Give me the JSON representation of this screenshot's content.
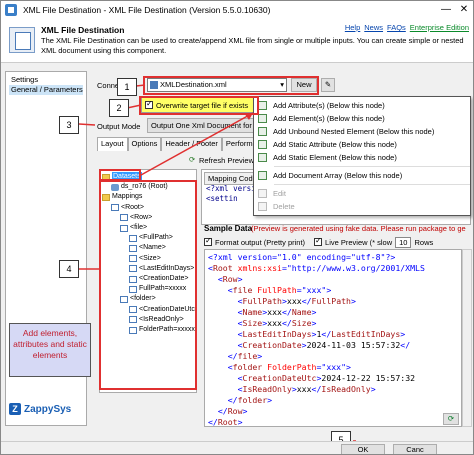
{
  "window": {
    "title": "XML File Destination - XML File Destination (Version 5.5.0.10630)",
    "minimize": "—",
    "close": "✕"
  },
  "header": {
    "title": "XML File Destination",
    "description": "The XML File Destination can be used to create/append XML file from single or multiple inputs. You can create simple or nested XML document using this component.",
    "links": [
      "Help",
      "News",
      "FAQs",
      "Enterprise Edition"
    ]
  },
  "leftnav": {
    "items": [
      "Settings",
      "General / Parameters"
    ]
  },
  "settings": {
    "connection_label": "Connec",
    "connection_value": "XMLDestination.xml",
    "new_button": "New",
    "overwrite_label": "Overwrite target file if exists",
    "output_mode_label": "Output Mode",
    "output_mode_value": "Output One Xml Document for all"
  },
  "tabs": [
    "Layout",
    "Options",
    "Header / Footer",
    "Performanc"
  ],
  "tree_toolbar": {
    "refresh": "Refresh Preview"
  },
  "tree": [
    {
      "label": "Datasets",
      "icon": "folder",
      "indent": 0,
      "selected": true
    },
    {
      "label": "ds_ro76 (Root)",
      "icon": "db",
      "indent": 1
    },
    {
      "label": "Mappings",
      "icon": "folder",
      "indent": 0
    },
    {
      "label": "<Root>",
      "icon": "doc",
      "indent": 1
    },
    {
      "label": "<Row>",
      "icon": "doc",
      "indent": 2
    },
    {
      "label": "<file>",
      "icon": "doc",
      "indent": 2
    },
    {
      "label": "<FullPath>",
      "icon": "doc",
      "indent": 3
    },
    {
      "label": "<Name>",
      "icon": "doc",
      "indent": 3
    },
    {
      "label": "<Size>",
      "icon": "doc",
      "indent": 3
    },
    {
      "label": "<LastEditInDays>",
      "icon": "doc",
      "indent": 3
    },
    {
      "label": "<CreationDate>",
      "icon": "doc",
      "indent": 3
    },
    {
      "label": "FullPath=xxxxx",
      "icon": "doc",
      "indent": 3
    },
    {
      "label": "<folder>",
      "icon": "doc",
      "indent": 2
    },
    {
      "label": "<CreationDateUtc>",
      "icon": "doc",
      "indent": 3
    },
    {
      "label": "<IsReadOnly>",
      "icon": "doc",
      "indent": 3
    },
    {
      "label": "FolderPath=xxxxx",
      "icon": "doc",
      "indent": 3
    }
  ],
  "mapping": {
    "tab": "Mapping Code",
    "lines": [
      "<?xml versio",
      "<settin"
    ]
  },
  "sample": {
    "title": "Sample Data",
    "note": "(Preview is generated using fake data. Please run package to ge",
    "format_output": "Format output (Pretty print)",
    "live_preview": "Live Preview (* slow",
    "rows_value": "10",
    "rows_label": "Rows"
  },
  "xml_preview": [
    [
      [
        "pl",
        "<?xml version=\"1.0\" encoding=\"utf-8\"?>"
      ]
    ],
    [
      [
        "pl",
        "<"
      ],
      [
        "tg",
        "Root"
      ],
      [
        "at",
        " xmlns:xsi"
      ],
      [
        "pl",
        "=\"http://www.w3.org/2001/XMLS"
      ]
    ],
    [
      [
        "pl",
        "  <"
      ],
      [
        "tg",
        "Row"
      ],
      [
        "pl",
        ">"
      ]
    ],
    [
      [
        "pl",
        "    <"
      ],
      [
        "tg",
        "file"
      ],
      [
        "at",
        " FullPath"
      ],
      [
        "pl",
        "=\"xxx\">"
      ]
    ],
    [
      [
        "pl",
        "      <"
      ],
      [
        "tg",
        "FullPath"
      ],
      [
        "pl",
        ">"
      ],
      [
        "tx",
        "xxx"
      ],
      [
        "pl",
        "</"
      ],
      [
        "tg",
        "FullPath"
      ],
      [
        "pl",
        ">"
      ]
    ],
    [
      [
        "pl",
        "      <"
      ],
      [
        "tg",
        "Name"
      ],
      [
        "pl",
        ">"
      ],
      [
        "tx",
        "xxx"
      ],
      [
        "pl",
        "</"
      ],
      [
        "tg",
        "Name"
      ],
      [
        "pl",
        ">"
      ]
    ],
    [
      [
        "pl",
        "      <"
      ],
      [
        "tg",
        "Size"
      ],
      [
        "pl",
        ">"
      ],
      [
        "tx",
        "xxx"
      ],
      [
        "pl",
        "</"
      ],
      [
        "tg",
        "Size"
      ],
      [
        "pl",
        ">"
      ]
    ],
    [
      [
        "pl",
        "      <"
      ],
      [
        "tg",
        "LastEditInDays"
      ],
      [
        "pl",
        ">"
      ],
      [
        "tx",
        "1"
      ],
      [
        "pl",
        "</"
      ],
      [
        "tg",
        "LastEditInDays"
      ],
      [
        "pl",
        ">"
      ]
    ],
    [
      [
        "pl",
        "      <"
      ],
      [
        "tg",
        "CreationDate"
      ],
      [
        "pl",
        ">"
      ],
      [
        "tx",
        "2024-11-03 15:57:32"
      ],
      [
        "pl",
        "</"
      ]
    ],
    [
      [
        "pl",
        "    </"
      ],
      [
        "tg",
        "file"
      ],
      [
        "pl",
        ">"
      ]
    ],
    [
      [
        "pl",
        "    <"
      ],
      [
        "tg",
        "folder"
      ],
      [
        "at",
        " FolderPath"
      ],
      [
        "pl",
        "=\"xxx\">"
      ]
    ],
    [
      [
        "pl",
        "      <"
      ],
      [
        "tg",
        "CreationDateUtc"
      ],
      [
        "pl",
        ">"
      ],
      [
        "tx",
        "2024-12-22 15:57:32"
      ]
    ],
    [
      [
        "pl",
        "      <"
      ],
      [
        "tg",
        "IsReadOnly"
      ],
      [
        "pl",
        ">"
      ],
      [
        "tx",
        "xxx"
      ],
      [
        "pl",
        "</"
      ],
      [
        "tg",
        "IsReadOnly"
      ],
      [
        "pl",
        ">"
      ]
    ],
    [
      [
        "pl",
        "    </"
      ],
      [
        "tg",
        "folder"
      ],
      [
        "pl",
        ">"
      ]
    ],
    [
      [
        "pl",
        "  </"
      ],
      [
        "tg",
        "Row"
      ],
      [
        "pl",
        ">"
      ]
    ],
    [
      [
        "pl",
        "</"
      ],
      [
        "tg",
        "Root"
      ],
      [
        "pl",
        ">"
      ]
    ]
  ],
  "context_menu": [
    {
      "label": "Add Attribute(s) (Below this node)",
      "enabled": true
    },
    {
      "label": "Add Element(s) (Below this node)",
      "enabled": true
    },
    {
      "label": "Add Unbound Nested Element (Below this node)",
      "enabled": true
    },
    {
      "label": "Add Static Attribute (Below this node)",
      "enabled": true
    },
    {
      "label": "Add Static Element (Below this node)",
      "enabled": true
    },
    {
      "sep": true
    },
    {
      "label": "Add Document Array (Below this node)",
      "enabled": true
    },
    {
      "sep": true
    },
    {
      "label": "Edit",
      "enabled": false
    },
    {
      "label": "Delete",
      "enabled": false
    }
  ],
  "callouts": [
    "1",
    "2",
    "3",
    "4",
    "5"
  ],
  "note": "Add elements, attributes and static elements",
  "logo": "ZappySys",
  "footer": {
    "ok": "OK",
    "cancel": "Canc"
  },
  "colors": {
    "callout_border": "#e03030",
    "highlight": "#ffff66",
    "note_bg": "#d6d9f5"
  }
}
